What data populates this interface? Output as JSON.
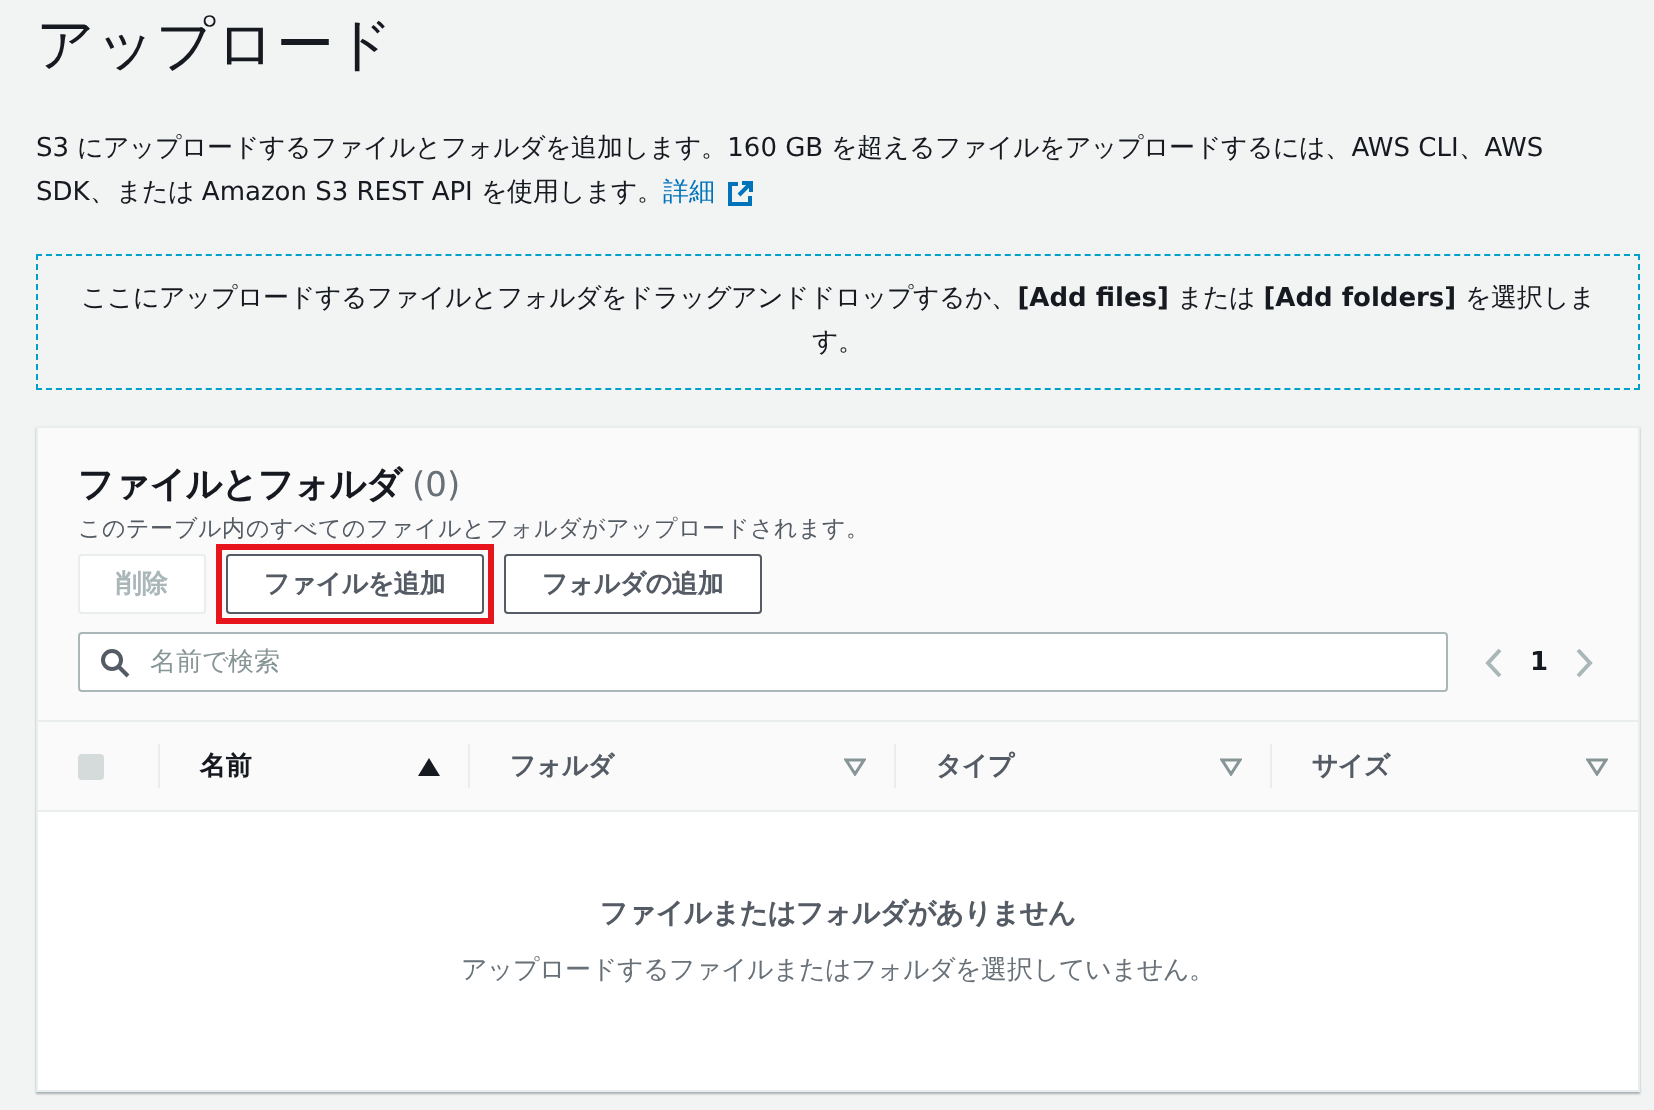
{
  "page_title": "アップロード",
  "description": {
    "text": "S3 にアップロードするファイルとフォルダを追加します。160 GB を超えるファイルをアップロードするには、AWS CLI、AWS SDK、または Amazon S3 REST API を使用します。",
    "link": "詳細"
  },
  "dropzone": {
    "text": "ここにアップロードするファイルとフォルダをドラッグアンドドロップするか、**[Add files]** または **[Add folders]** を選択します。"
  },
  "panel": {
    "title": "ファイルとフォルダ",
    "count": "(0)",
    "subtitle": "このテーブル内のすべてのファイルとフォルダがアップロードされます。",
    "buttons": [
      {
        "label": "削除",
        "disabled": true,
        "highlighted": false
      },
      {
        "label": "ファイルを追加",
        "disabled": false,
        "highlighted": true
      },
      {
        "label": "フォルダの追加",
        "disabled": false,
        "highlighted": false
      }
    ],
    "search": {
      "placeholder": "名前で検索"
    },
    "pagination": {
      "page": "1"
    },
    "table": {
      "select_all_checked": false,
      "columns": [
        {
          "label": "名前",
          "sorted": true
        },
        {
          "label": "フォルダ",
          "sorted": false
        },
        {
          "label": "タイプ",
          "sorted": false
        },
        {
          "label": "サイズ",
          "sorted": false
        }
      ],
      "empty_title": "ファイルまたはフォルダがありません",
      "empty_text": "アップロードするファイルまたはフォルダを選択していません。"
    }
  }
}
